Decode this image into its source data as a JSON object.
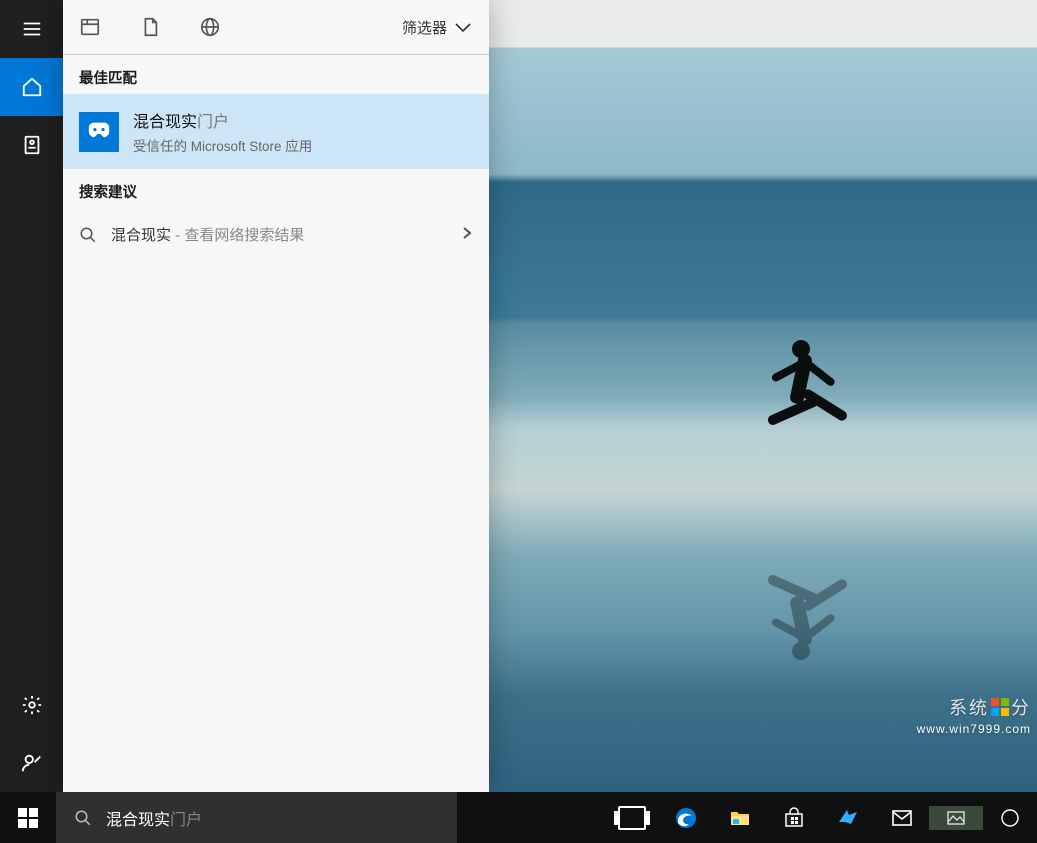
{
  "search": {
    "typed": "混合现实",
    "ghost": "门户",
    "placeholder": "混合现实门户"
  },
  "panel_header": {
    "filter_label": "筛选器"
  },
  "sections": {
    "best_match_label": "最佳匹配",
    "search_suggestions_label": "搜索建议"
  },
  "best_match": {
    "title_bold": "混合现实",
    "title_ghost": "门户",
    "subtitle": "受信任的 Microsoft Store 应用"
  },
  "suggestion": {
    "query": "混合现实",
    "hint_sep": " - ",
    "hint_text": "查看网络搜索结果"
  },
  "rail": {
    "items": [
      "menu",
      "home",
      "notebook",
      "settings",
      "feedback"
    ]
  },
  "watermark": {
    "main": "系统    分",
    "sub": "www.win7999.com"
  },
  "taskbar": {
    "apps": [
      "task-view",
      "edge",
      "file-explorer",
      "store",
      "app-blue",
      "mail",
      "app-grey",
      "app-partial"
    ]
  }
}
